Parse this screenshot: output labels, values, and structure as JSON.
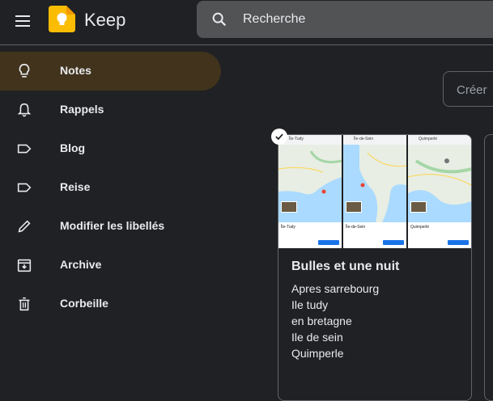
{
  "app": {
    "name": "Keep"
  },
  "search": {
    "placeholder": "Recherche"
  },
  "sidebar": {
    "items": [
      {
        "label": "Notes",
        "icon": "lightbulb-icon",
        "active": true
      },
      {
        "label": "Rappels",
        "icon": "bell-icon",
        "active": false
      },
      {
        "label": "Blog",
        "icon": "label-icon",
        "active": false
      },
      {
        "label": "Reise",
        "icon": "label-icon",
        "active": false
      },
      {
        "label": "Modifier les libellés",
        "icon": "pencil-icon",
        "active": false
      },
      {
        "label": "Archive",
        "icon": "archive-icon",
        "active": false
      },
      {
        "label": "Corbeille",
        "icon": "trash-icon",
        "active": false
      }
    ]
  },
  "create": {
    "placeholder": "Créer"
  },
  "note": {
    "title": "Bulles et une nuit",
    "lines": [
      "Apres sarrebourg",
      "Ile tudy",
      "en bretagne",
      "Ile de sein",
      "Quimperle"
    ],
    "thumbnails": [
      {
        "header": "Île-Tudy",
        "place": "Île-Tudy"
      },
      {
        "header": "Île-de-Sein",
        "place": "Île-de-Sein"
      },
      {
        "header": "Quimperlé",
        "place": "Quimperlé"
      }
    ]
  },
  "colors": {
    "background": "#202124",
    "active_item": "#41331c",
    "search_bg": "#525355",
    "logo_yellow": "#fbbc04",
    "border": "#5f6368"
  }
}
